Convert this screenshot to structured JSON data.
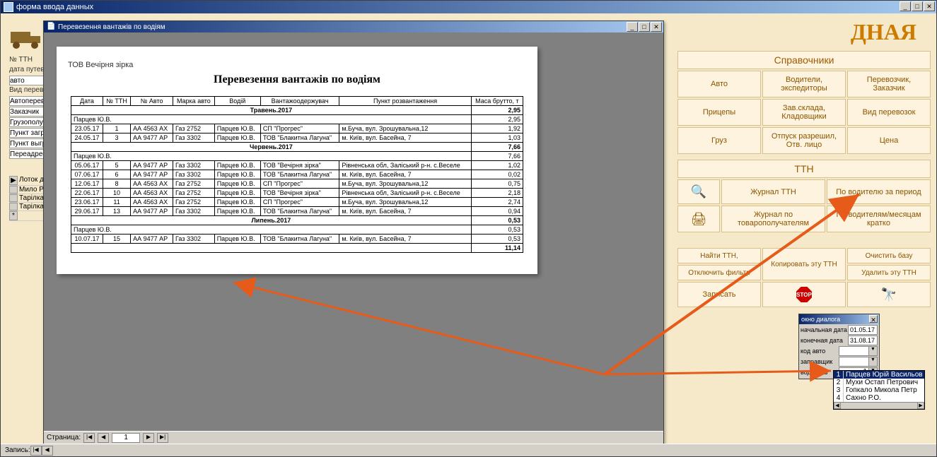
{
  "outer_window": {
    "title": "форма ввода данных"
  },
  "big_title": "ДНАЯ",
  "sections": {
    "spravochniki": "Справочники",
    "ttn": "ТТН"
  },
  "buttons": {
    "avto": "Авто",
    "voditeli": "Водители, экспедиторы",
    "perevozchik": "Перевозчик, Заказчик",
    "pricepy": "Прицепы",
    "zavsklada": "Зав.склада, Кладовщики",
    "vid_perevozok": "Вид перевозок",
    "gruz": "Груз",
    "otpusk": "Отпуск разрешил, Отв. лицо",
    "cena": "Цена",
    "journal_ttn": "Журнал ТТН",
    "po_voditelu_period": "По водителю за период",
    "journal_tovar": "Журнал по товарополучателям",
    "po_voditelyam_kratko": "По водителям/месяцам кратко",
    "najti_ttn": "Найти ТТН,",
    "otkl_filter": "Отключить фильтр",
    "kopirovat": "Копировать эту ТТН",
    "ochistit": "Очистить базу",
    "udalit": "Удалить эту ТТН",
    "zapisat": "Записать",
    "stop": "STOP",
    "binoc": "🔍"
  },
  "left_form": {
    "labels": [
      "№ ТТН",
      "дата путев",
      "авто",
      "Вид переве",
      "Автоперев",
      "Заказчик",
      "Грузополуч",
      "Пункт загр",
      "Пункт выгр",
      "Переадрес"
    ],
    "grid_items": [
      "Лоток д",
      "Мило Р",
      "Тарілка",
      "Тарілка"
    ]
  },
  "report": {
    "window_title": "Перевезення вантажів по водіям",
    "org": "ТОВ Вечірня зірка",
    "title": "Перевезення вантажів по водіям",
    "headers": [
      "Дата",
      "№ ТТН",
      "№ Авто",
      "Марка авто",
      "Водій",
      "Вантажоодержувач",
      "Пункт розвантаження",
      "Маса брутто, т"
    ],
    "months": [
      {
        "label": "Травень.2017",
        "total": "2,95",
        "driver": "Парцев Ю.В.",
        "driver_total": "2,95",
        "rows": [
          [
            "23.05.17",
            "1",
            "АА 4563 АХ",
            "Газ 2752",
            "Парцев Ю.В.",
            "СП \"Прогрес\"",
            "м.Буча, вул. Зрошувальна,12",
            "1,92"
          ],
          [
            "24.05.17",
            "3",
            "АА 9477 АР",
            "Газ 3302",
            "Парцев Ю.В.",
            "ТОВ \"Блакитна Лагуна\"",
            "м. Київ, вул. Басейна, 7",
            "1,03"
          ]
        ]
      },
      {
        "label": "Червень.2017",
        "total": "7,66",
        "driver": "Парцев Ю.В.",
        "driver_total": "7,66",
        "rows": [
          [
            "05.06.17",
            "5",
            "АА 9477 АР",
            "Газ 3302",
            "Парцев Ю.В.",
            "ТОВ \"Вечірня зірка\"",
            "Рівненська обл, Заліський р-н. с.Веселе",
            "1,02"
          ],
          [
            "07.06.17",
            "6",
            "АА 9477 АР",
            "Газ 3302",
            "Парцев Ю.В.",
            "ТОВ \"Блакитна Лагуна\"",
            "м. Київ, вул. Басейна, 7",
            "0,02"
          ],
          [
            "12.06.17",
            "8",
            "АА 4563 АХ",
            "Газ 2752",
            "Парцев Ю.В.",
            "СП \"Прогрес\"",
            "м.Буча, вул. Зрошувальна,12",
            "0,75"
          ],
          [
            "22.06.17",
            "10",
            "АА 4563 АХ",
            "Газ 2752",
            "Парцев Ю.В.",
            "ТОВ \"Вечірня зірка\"",
            "Рівненська обл, Заліський р-н. с.Веселе",
            "2,18"
          ],
          [
            "23.06.17",
            "11",
            "АА 4563 АХ",
            "Газ 2752",
            "Парцев Ю.В.",
            "СП \"Прогрес\"",
            "м.Буча, вул. Зрошувальна,12",
            "2,74"
          ],
          [
            "29.06.17",
            "13",
            "АА 9477 АР",
            "Газ 3302",
            "Парцев Ю.В.",
            "ТОВ \"Блакитна Лагуна\"",
            "м. Київ, вул. Басейна, 7",
            "0,94"
          ]
        ]
      },
      {
        "label": "Липень.2017",
        "total": "0,53",
        "driver": "Парцев Ю.В.",
        "driver_total": "0,53",
        "rows": [
          [
            "10.07.17",
            "15",
            "АА 9477 АР",
            "Газ 3302",
            "Парцев Ю.В.",
            "ТОВ \"Блакитна Лагуна\"",
            "м. Київ, вул. Басейна, 7",
            "0,53"
          ]
        ]
      }
    ],
    "grand_total": "11,14",
    "page_label": "Страница:",
    "page_value": "1"
  },
  "dialog": {
    "title": "окно диалога",
    "start_label": "начальная дата",
    "start_value": "01.05.17",
    "end_label": "конечная дата",
    "end_value": "31.08.17",
    "code_avto": "код авто",
    "zapravshik": "заправщик",
    "voditel": "водитель",
    "voditel_value": "1"
  },
  "dropdown": {
    "items": [
      {
        "n": "1",
        "name": "Парцев Юрій Васильов"
      },
      {
        "n": "2",
        "name": "Мухи Остап Петрович"
      },
      {
        "n": "3",
        "name": "Гопкало Микола Петр"
      },
      {
        "n": "4",
        "name": "Сахно Р.О."
      }
    ]
  },
  "bottom_status": {
    "label": "Запись:"
  }
}
